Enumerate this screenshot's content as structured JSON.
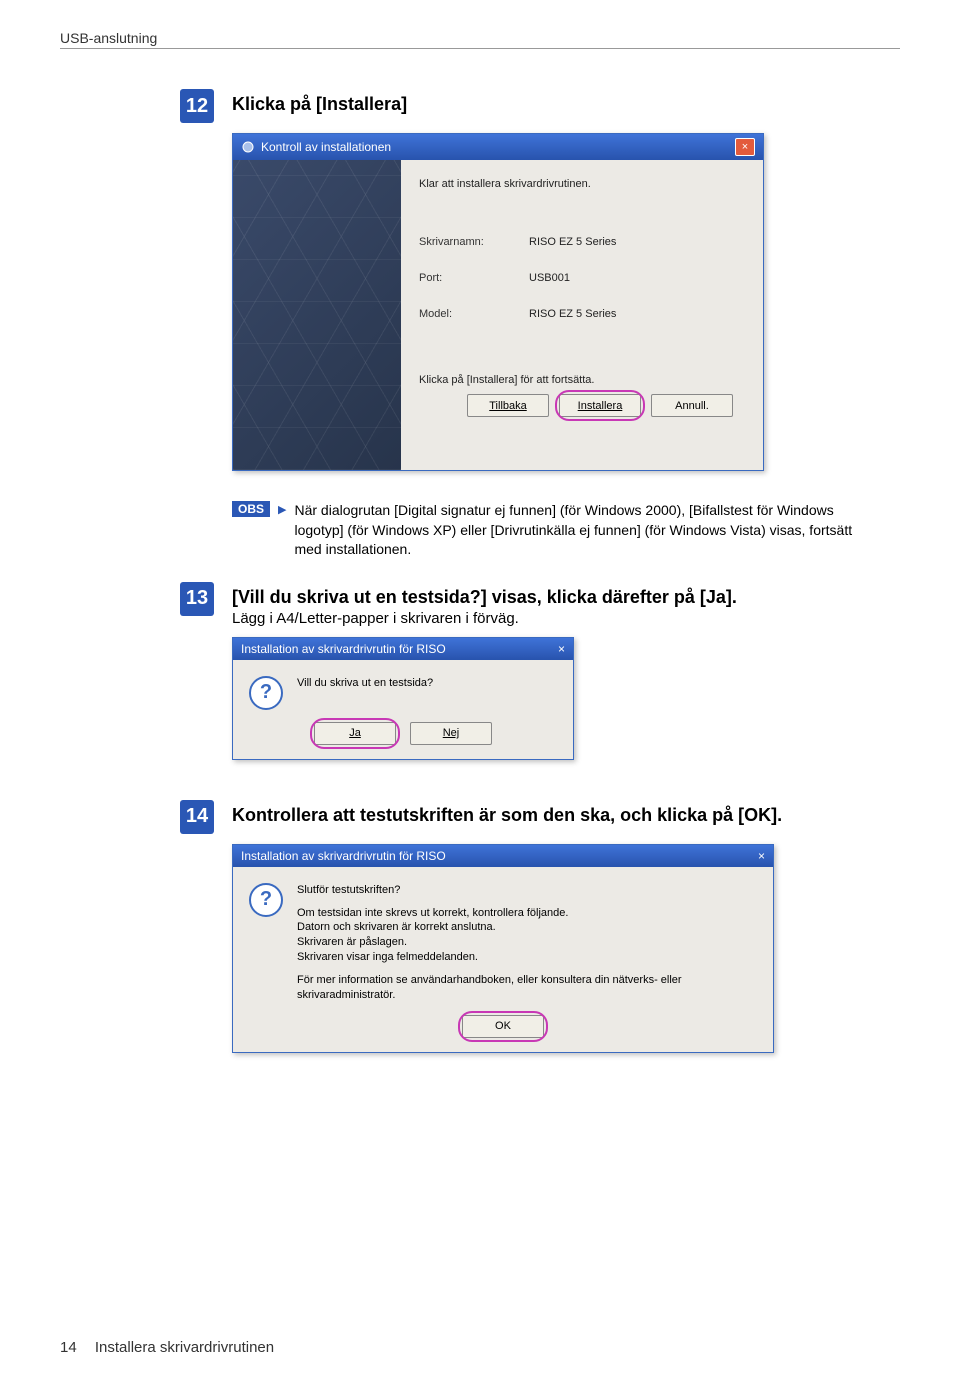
{
  "header": {
    "section": "USB-anslutning"
  },
  "steps": {
    "s12": {
      "num": "12",
      "heading": "Klicka på [Installera]"
    },
    "s13": {
      "num": "13",
      "heading": "[Vill du skriva ut en testsida?] visas, klicka därefter på [Ja].",
      "sub": "Lägg i A4/Letter-papper i skrivaren i förväg."
    },
    "s14": {
      "num": "14",
      "heading": "Kontrollera att testutskriften är som den ska, och klicka på [OK]."
    }
  },
  "obs": {
    "tag": "OBS",
    "text": "När dialogrutan [Digital signatur ej funnen] (för Windows 2000), [Bifallstest för Windows logotyp] (för Windows XP) eller [Drivrutinkälla ej funnen] (för Windows Vista) visas, fortsätt med installationen."
  },
  "dlg1": {
    "title": "Kontroll av installationen",
    "intro": "Klar att installera skrivardrivrutinen.",
    "rows": {
      "name_l": "Skrivarnamn:",
      "name_v": "RISO EZ 5 Series",
      "port_l": "Port:",
      "port_v": "USB001",
      "model_l": "Model:",
      "model_v": "RISO EZ 5 Series"
    },
    "hint": "Klicka på [Installera] för att fortsätta.",
    "buttons": {
      "back": "Tillbaka",
      "install": "Installera",
      "cancel": "Annull."
    }
  },
  "dlg2": {
    "title": "Installation av skrivardrivrutin för RISO",
    "question": "Vill du skriva ut en testsida?",
    "yes": "Ja",
    "no": "Nej"
  },
  "dlg3": {
    "title": "Installation av skrivardrivrutin för RISO",
    "q1": "Slutför testutskriften?",
    "l1": "Om testsidan inte skrevs ut korrekt, kontrollera följande.",
    "l2": "Datorn och skrivaren är korrekt anslutna.",
    "l3": "Skrivaren är påslagen.",
    "l4": "Skrivaren visar inga felmeddelanden.",
    "l5": "För mer information se användarhandboken, eller konsultera din nätverks- eller skrivaradministratör.",
    "ok": "OK"
  },
  "footer": {
    "pagenum": "14",
    "text": "Installera skrivardrivrutinen"
  }
}
